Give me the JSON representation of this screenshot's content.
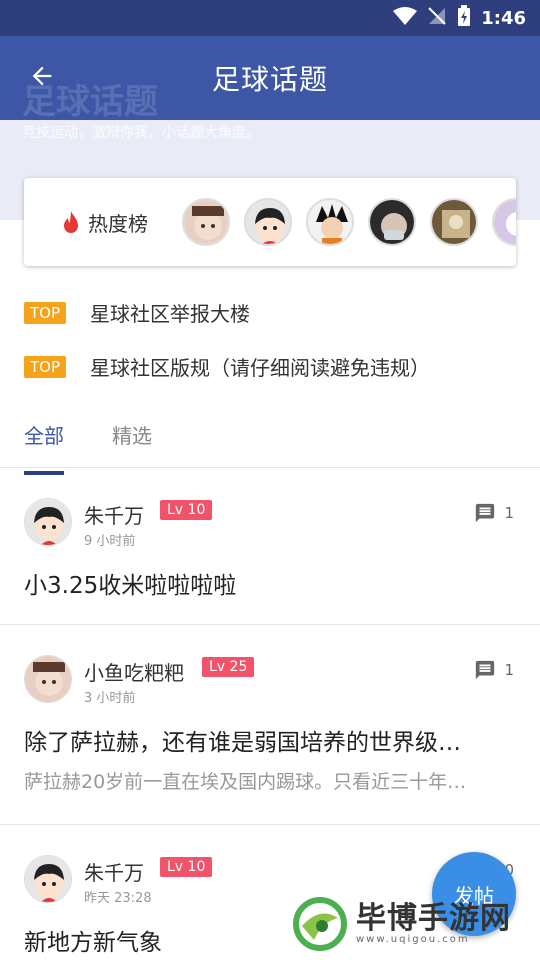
{
  "status_bar": {
    "time": "1:46"
  },
  "header": {
    "title": "足球话题",
    "banner_title": "足球话题",
    "banner_subtitle": "竞技运动，激辩你我，小话题大角度。"
  },
  "hot": {
    "label": "热度榜"
  },
  "top_items": [
    {
      "tag": "TOP",
      "text": "星球社区举报大楼"
    },
    {
      "tag": "TOP",
      "text": "星球社区版规（请仔细阅读避免违规）"
    }
  ],
  "tabs": [
    {
      "label": "全部",
      "active": true
    },
    {
      "label": "精选",
      "active": false
    }
  ],
  "posts": [
    {
      "user": "朱千万",
      "level": "Lv 10",
      "time": "9 小时前",
      "comments": "1",
      "title": "小3.25收米啦啦啦啦",
      "excerpt": ""
    },
    {
      "user": "小鱼吃粑粑",
      "level": "Lv 25",
      "time": "3 小时前",
      "comments": "1",
      "title": "除了萨拉赫，还有谁是弱国培养的世界级…",
      "excerpt": "萨拉赫20岁前一直在埃及国内踢球。只看近三十年…"
    },
    {
      "user": "朱千万",
      "level": "Lv 10",
      "time": "昨天 23:28",
      "comments": "0",
      "title": "新地方新气象",
      "excerpt": ""
    }
  ],
  "fab": {
    "label": "发帖"
  },
  "watermark": {
    "name": "毕博手游网",
    "url": "www.uqigou.com"
  },
  "colors": {
    "status_bar": "#2f3f7e",
    "header": "#3d56a6",
    "banner": "#e9ecf7",
    "level_badge": "#f1546a",
    "top_tag": "#f7a21b",
    "fab": "#3a8ee6"
  }
}
